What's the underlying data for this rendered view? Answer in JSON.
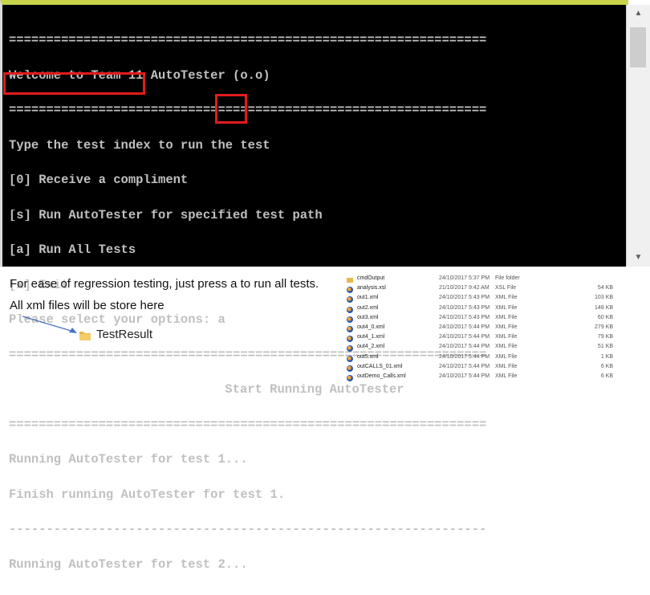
{
  "console": {
    "lines": [
      "================================================================",
      "Welcome to Team 11 AutoTester (o.o)",
      "================================================================",
      "Type the test index to run the test",
      "[0] Receive a compliment",
      "[s] Run AutoTester for specified test path",
      "[a] Run All Tests",
      "[x] Exit",
      "Please select your options: a",
      "================================================================",
      "Start Running AutoTester",
      "================================================================",
      "Running AutoTester for test 1...",
      "Finish running AutoTester for test 1.",
      "----------------------------------------------------------------",
      "Running AutoTester for test 2..."
    ]
  },
  "annotations": {
    "note_regression": "For ease of regression testing, just press a to run all tests.",
    "note_xml": "All xml files will be store here",
    "folder_label": "TestResult"
  },
  "file_list": [
    {
      "name": "cmdOutput",
      "date": "24/10/2017 5:37 PM",
      "type": "File folder",
      "size": "",
      "icon": "folder-icon"
    },
    {
      "name": "analysis.xsl",
      "date": "21/10/2017 9:42 AM",
      "type": "XSL File",
      "size": "54 KB",
      "icon": "browser-file-icon"
    },
    {
      "name": "out1.xml",
      "date": "24/10/2017 5:43 PM",
      "type": "XML File",
      "size": "103 KB",
      "icon": "browser-file-icon"
    },
    {
      "name": "out2.xml",
      "date": "24/10/2017 5:43 PM",
      "type": "XML File",
      "size": "148 KB",
      "icon": "browser-file-icon"
    },
    {
      "name": "out3.xml",
      "date": "24/10/2017 5:43 PM",
      "type": "XML File",
      "size": "60 KB",
      "icon": "browser-file-icon"
    },
    {
      "name": "out4_0.xml",
      "date": "24/10/2017 5:44 PM",
      "type": "XML File",
      "size": "279 KB",
      "icon": "browser-file-icon"
    },
    {
      "name": "out4_1.xml",
      "date": "24/10/2017 5:44 PM",
      "type": "XML File",
      "size": "79 KB",
      "icon": "browser-file-icon"
    },
    {
      "name": "out4_2.xml",
      "date": "24/10/2017 5:44 PM",
      "type": "XML File",
      "size": "51 KB",
      "icon": "browser-file-icon"
    },
    {
      "name": "out5.xml",
      "date": "24/10/2017 5:44 PM",
      "type": "XML File",
      "size": "1 KB",
      "icon": "browser-file-icon"
    },
    {
      "name": "outCALLS_01.xml",
      "date": "24/10/2017 5:44 PM",
      "type": "XML File",
      "size": "6 KB",
      "icon": "browser-file-icon"
    },
    {
      "name": "outDemo_Calls.xml",
      "date": "24/10/2017 5:44 PM",
      "type": "XML File",
      "size": "6 KB",
      "icon": "browser-file-icon"
    }
  ],
  "colors": {
    "console_bg": "#000000",
    "console_text": "#c0c0c0",
    "highlight": "#e31b1b",
    "title_bar": "#c8d44a"
  }
}
